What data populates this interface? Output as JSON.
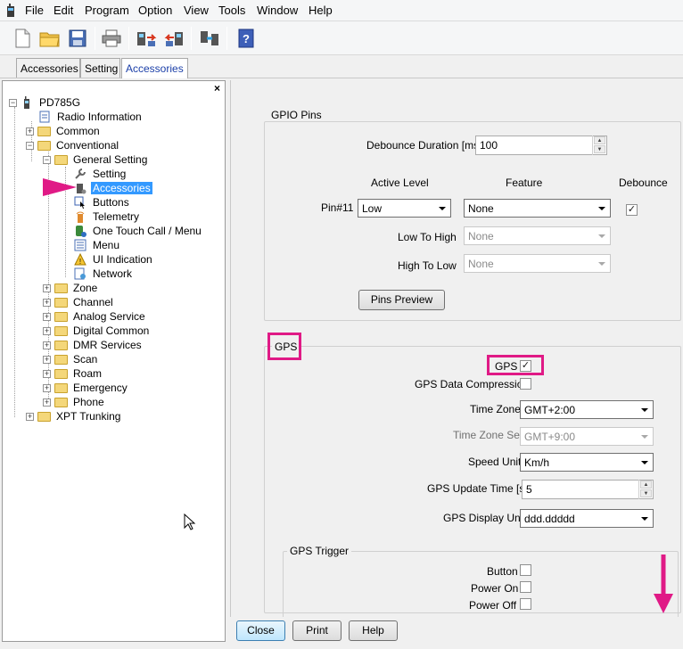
{
  "menubar": {
    "items": [
      "File",
      "Edit",
      "Program",
      "Option",
      "View",
      "Tools",
      "Window",
      "Help"
    ]
  },
  "toolbar": {
    "buttons": [
      "new-icon",
      "open-folder-icon",
      "save-icon",
      "print-icon",
      "read-radio-icon",
      "write-radio-icon",
      "clone-icon",
      "help-icon"
    ]
  },
  "tabs": [
    "Accessories",
    "Setting",
    "Accessories"
  ],
  "tree": {
    "root": "PD785G",
    "radio_information": "Radio Information",
    "common": "Common",
    "conventional": "Conventional",
    "general_setting": "General Setting",
    "setting": "Setting",
    "accessories": "Accessories",
    "buttons": "Buttons",
    "telemetry": "Telemetry",
    "one_touch": "One Touch Call / Menu",
    "menu": "Menu",
    "ui_indication": "UI Indication",
    "network": "Network",
    "zone": "Zone",
    "channel": "Channel",
    "analog_service": "Analog Service",
    "digital_common": "Digital Common",
    "dmr_services": "DMR Services",
    "scan": "Scan",
    "roam": "Roam",
    "emergency": "Emergency",
    "phone": "Phone",
    "xpt_trunking": "XPT Trunking",
    "close_glyph": "×"
  },
  "gpio": {
    "title": "GPIO Pins",
    "debounce_label": "Debounce Duration [ms]",
    "debounce_value": "100",
    "col_active_level": "Active Level",
    "col_feature": "Feature",
    "col_debounce": "Debounce",
    "pin_label": "Pin#11",
    "active_level": "Low",
    "feature": "None",
    "debounce_checked": "✓",
    "low_to_high_label": "Low To High",
    "low_to_high_value": "None",
    "high_to_low_label": "High To Low",
    "high_to_low_value": "None",
    "pins_preview": "Pins Preview"
  },
  "gps": {
    "title": "GPS",
    "gps_label": "GPS",
    "gps_checked": "✓",
    "compression_label": "GPS Data Compression",
    "time_zone_label": "Time Zone",
    "time_zone_value": "GMT+2:00",
    "time_zone_set_label": "Time Zone Set",
    "time_zone_set_value": "GMT+9:00",
    "speed_unit_label": "Speed Unit",
    "speed_unit_value": "Km/h",
    "update_time_label": "GPS Update Time [s]",
    "update_time_value": "5",
    "display_unit_label": "GPS Display Unit",
    "display_unit_value": "ddd.ddddd"
  },
  "gps_trigger": {
    "title": "GPS Trigger",
    "button_label": "Button",
    "power_on_label": "Power On",
    "power_off_label": "Power Off"
  },
  "footer": {
    "close": "Close",
    "print": "Print",
    "help": "Help"
  },
  "colors": {
    "annotation": "#e01a86",
    "selection": "#3399ff",
    "tab_active_text": "#1b3fa8"
  }
}
